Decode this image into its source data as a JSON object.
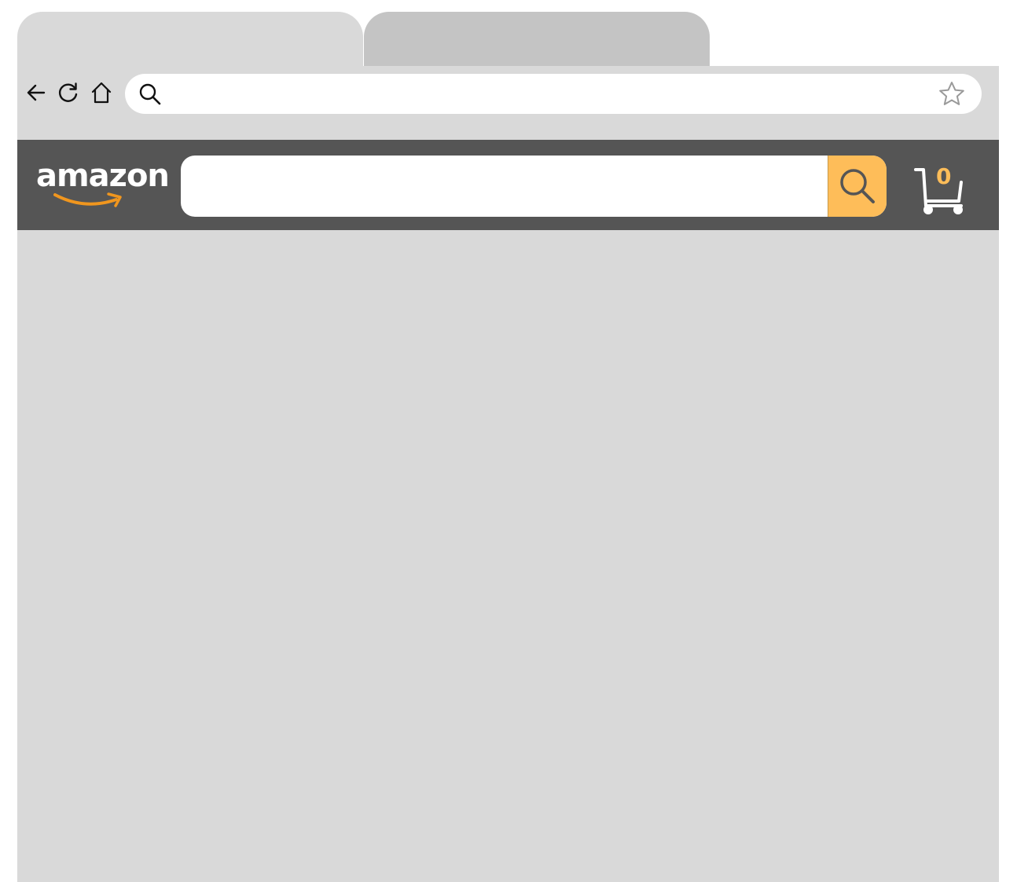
{
  "browser": {
    "address_bar": {
      "value": "",
      "placeholder": ""
    },
    "icons": {
      "back": "back-arrow-icon",
      "reload": "reload-icon",
      "home": "home-icon",
      "address_search": "search-icon",
      "bookmark": "star-icon"
    }
  },
  "site": {
    "logo_text": "amazon",
    "search": {
      "value": "",
      "placeholder": ""
    },
    "cart": {
      "count": "0"
    },
    "colors": {
      "header_bg": "#555555",
      "accent": "#febd59",
      "logo_smile": "#f0961e"
    }
  }
}
